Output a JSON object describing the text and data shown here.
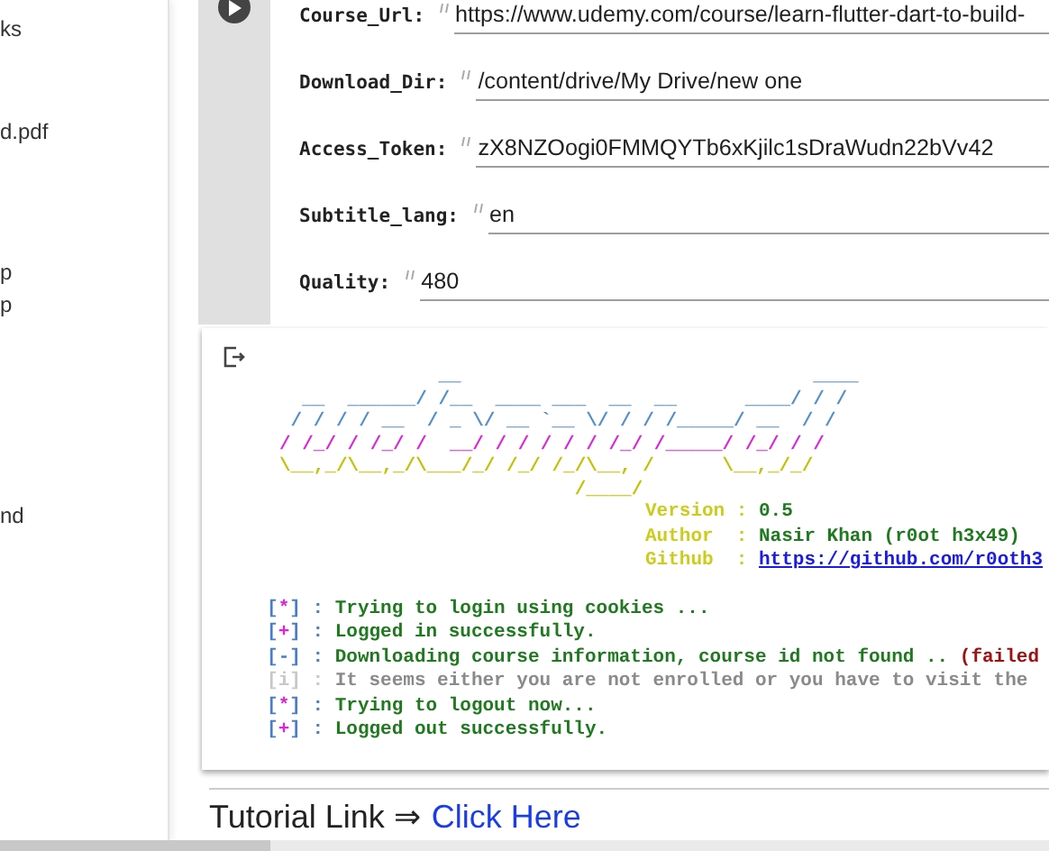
{
  "sidebar": {
    "items": [
      "ks",
      "d.pdf",
      "p",
      "p",
      "nd"
    ]
  },
  "form": {
    "fields": [
      {
        "label": "Course_Url:",
        "value": "https://www.udemy.com/course/learn-flutter-dart-to-build-"
      },
      {
        "label": "Download_Dir:",
        "value": "/content/drive/My Drive/new one"
      },
      {
        "label": "Access_Token:",
        "value": "zX8NZOogi0FMMQYTb6xKjilc1sDraWudn22bVv42"
      },
      {
        "label": "Subtitle_lang:",
        "value": "en"
      },
      {
        "label": "Quality:",
        "value": "480"
      }
    ]
  },
  "output": {
    "ascii_art": [
      {
        "text": "              __                               ____",
        "kind": "layer1"
      },
      {
        "text": "  __  ______/ /__  ____ ___  __  __      ____/ / /",
        "kind": "layer1"
      },
      {
        "text": " / / / / __  / _ \\/ __ `__ \\/ / / /_____/ __  / /",
        "kind": "layer1"
      },
      {
        "text": "/ /_/ / /_/ /  __/ / / / / / /_/ /_____/ /_/ / /",
        "kind": "layer2"
      },
      {
        "text": "\\__,_/\\__,_/\\___/_/ /_/ /_/\\__, /      \\__,_/_/",
        "kind": "layer3"
      },
      {
        "text": "                          /____/",
        "kind": "layer3"
      }
    ],
    "info": [
      {
        "kind": "text",
        "label": "Version",
        "separator": ":",
        "value": "0.5"
      },
      {
        "kind": "text",
        "label": "Author",
        "separator": ":",
        "value": "Nasir Khan (r0ot h3x49)"
      },
      {
        "kind": "link",
        "label": "Github",
        "separator": ":",
        "value": "https://github.com/r0oth3"
      }
    ],
    "log": [
      {
        "kind": "progress",
        "marker": "[*]",
        "separator": ":",
        "message": "Trying to login using cookies ..."
      },
      {
        "kind": "success",
        "marker": "[+]",
        "separator": ":",
        "message": "Logged in successfully."
      },
      {
        "kind": "error",
        "marker": "[-]",
        "separator": ":",
        "message": "Downloading course information, course id not found .. ",
        "status_text": "(failed"
      },
      {
        "kind": "note",
        "marker": "[i]",
        "separator": ":",
        "message": "It seems either you are not enrolled or you have to visit the"
      },
      {
        "kind": "progress",
        "marker": "[*]",
        "separator": ":",
        "message": "Trying to logout now..."
      },
      {
        "kind": "success",
        "marker": "[+]",
        "separator": ":",
        "message": "Logged out successfully."
      }
    ]
  },
  "footer": {
    "text": "Tutorial Link ⇒",
    "link": "Click Here"
  }
}
